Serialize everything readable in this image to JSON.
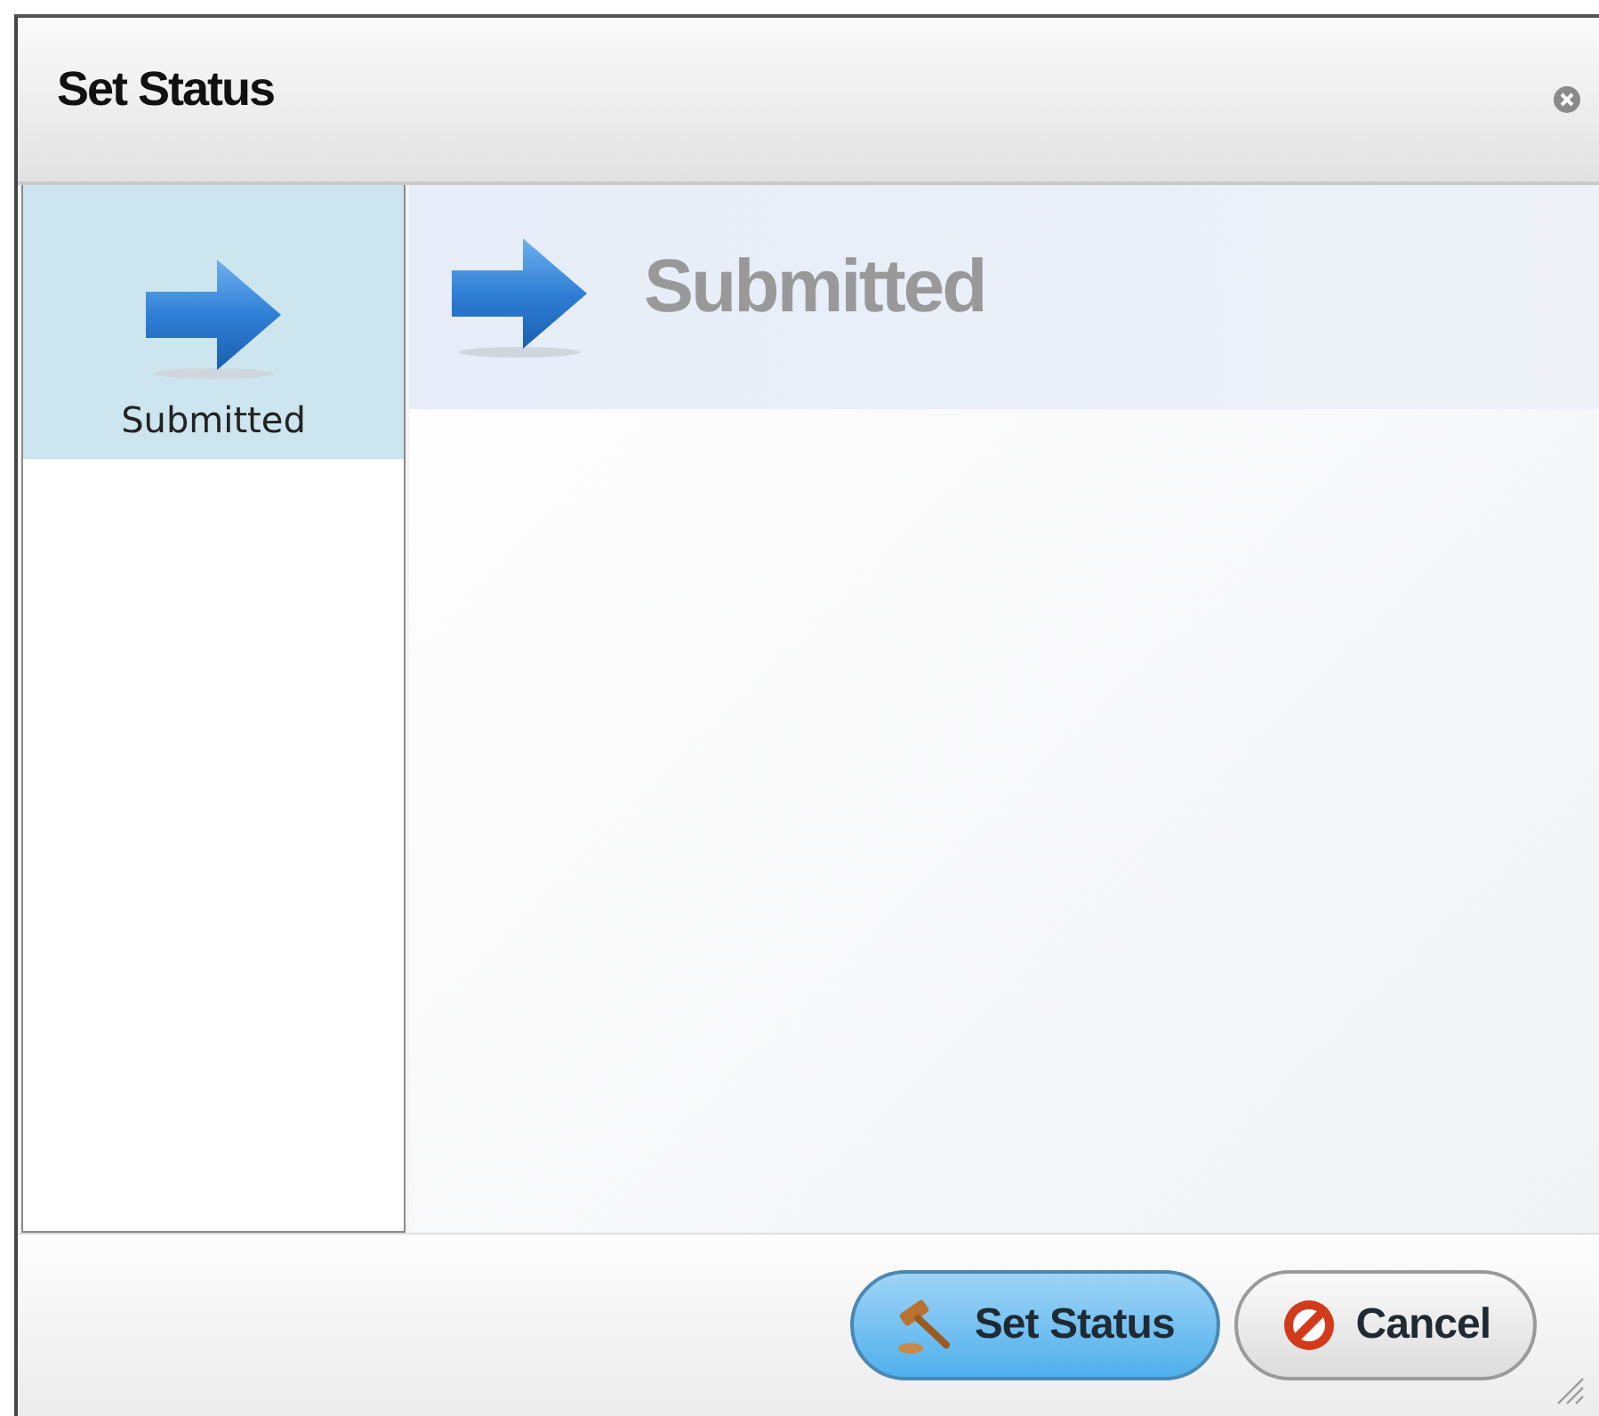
{
  "dialog": {
    "title": "Set Status"
  },
  "status_list": [
    {
      "label": "Submitted",
      "selected": true
    }
  ],
  "detail": {
    "title": "Submitted"
  },
  "buttons": [
    {
      "label": "Set Status",
      "kind": "primary"
    },
    {
      "label": "Cancel",
      "kind": "cancel"
    }
  ]
}
